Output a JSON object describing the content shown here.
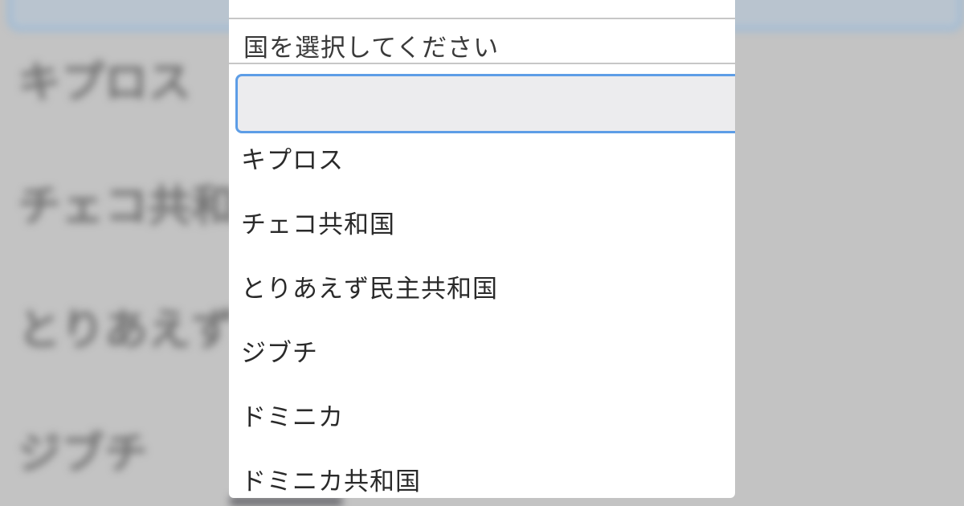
{
  "background": {
    "items": [
      "キプロス",
      "チェコ共和国",
      "とりあえず民主共和国",
      "ジブチ"
    ]
  },
  "dropdown": {
    "header": "国を選択してください",
    "search": {
      "value": "",
      "placeholder": ""
    },
    "options": [
      "キプロス",
      "チェコ共和国",
      "とりあえず民主共和国",
      "ジブチ",
      "ドミニカ",
      "ドミニカ共和国"
    ]
  },
  "colors": {
    "focus_border": "#5d9de6",
    "overlay": "#c3c3c3"
  }
}
